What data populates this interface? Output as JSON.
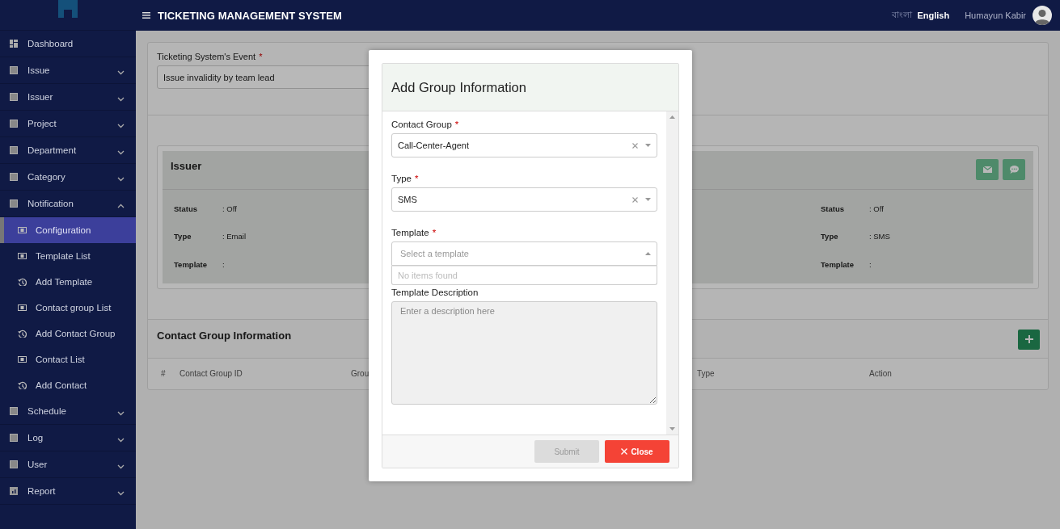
{
  "header": {
    "title": "TICKETING MANAGEMENT SYSTEM",
    "languages": [
      {
        "label": "বাংলা",
        "selected": false
      },
      {
        "label": "English",
        "selected": true
      }
    ],
    "user_name": "Humayun Kabir"
  },
  "sidebar": {
    "items": [
      {
        "label": "Dashboard",
        "kind": "dashboard"
      },
      {
        "label": "Issue",
        "kind": "module",
        "expanded": false
      },
      {
        "label": "Issuer",
        "kind": "module",
        "expanded": false
      },
      {
        "label": "Project",
        "kind": "module",
        "expanded": false
      },
      {
        "label": "Department",
        "kind": "module",
        "expanded": false
      },
      {
        "label": "Category",
        "kind": "module",
        "expanded": false
      },
      {
        "label": "Notification",
        "kind": "module",
        "expanded": true,
        "children": [
          {
            "label": "Configuration",
            "kind": "list",
            "selected": true
          },
          {
            "label": "Template List",
            "kind": "list",
            "selected": false
          },
          {
            "label": "Add Template",
            "kind": "form",
            "selected": false
          },
          {
            "label": "Contact group List",
            "kind": "list",
            "selected": false
          },
          {
            "label": "Add Contact Group",
            "kind": "form",
            "selected": false
          },
          {
            "label": "Contact List",
            "kind": "list",
            "selected": false
          },
          {
            "label": "Add Contact",
            "kind": "form",
            "selected": false
          }
        ]
      },
      {
        "label": "Schedule",
        "kind": "module",
        "expanded": false
      },
      {
        "label": "Log",
        "kind": "module",
        "expanded": false
      },
      {
        "label": "User",
        "kind": "module",
        "expanded": false
      },
      {
        "label": "Report",
        "kind": "report",
        "expanded": false
      }
    ]
  },
  "event_field": {
    "label": "Ticketing System's Event",
    "required_mark": "*",
    "value": "Issue invalidity by team lead"
  },
  "issuer": {
    "title": "Issuer",
    "actions": [
      {
        "kind": "email"
      },
      {
        "kind": "chat"
      }
    ],
    "columns": [
      [
        {
          "label": "Status",
          "value": ": Off"
        },
        {
          "label": "Type",
          "value": ": Email"
        },
        {
          "label": "Template",
          "value": ":"
        }
      ],
      [
        {
          "label": "Status",
          "value": ": Off"
        },
        {
          "label": "Type",
          "value": ": SMS"
        },
        {
          "label": "Template",
          "value": ":"
        }
      ]
    ]
  },
  "contact_groups": {
    "title": "Contact Group Information",
    "columns": [
      "#",
      "Contact Group ID",
      "Grou",
      "Type",
      "Action"
    ]
  },
  "modal": {
    "title": "Add Group Information",
    "fields": [
      {
        "kind": "select",
        "label": "Contact Group",
        "required_mark": "*",
        "value": "Call-Center-Agent",
        "open": false
      },
      {
        "kind": "select",
        "label": "Type",
        "required_mark": "*",
        "value": "SMS",
        "open": false
      },
      {
        "kind": "select",
        "label": "Template",
        "required_mark": "*",
        "placeholder": "Select a template",
        "open": true,
        "dropdown_message": "No items found"
      },
      {
        "kind": "textarea",
        "label": "Template Description",
        "placeholder": "Enter a description here"
      }
    ],
    "buttons": [
      {
        "kind": "submit",
        "label": "Submit",
        "disabled": true
      },
      {
        "kind": "close",
        "label": "Close",
        "disabled": false
      }
    ]
  }
}
